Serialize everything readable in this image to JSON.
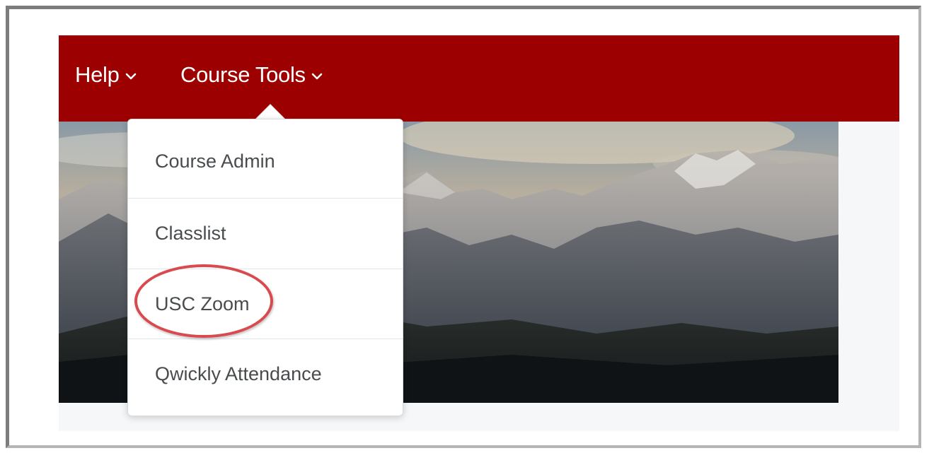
{
  "navbar": {
    "items": [
      {
        "label": "Help",
        "icon": "chevron-down-icon"
      },
      {
        "label": "Course Tools",
        "icon": "chevron-down-icon"
      }
    ],
    "background_color": "#9c0000"
  },
  "course_tools_menu": {
    "items": [
      {
        "label": "Course Admin"
      },
      {
        "label": "Classlist"
      },
      {
        "label": "USC Zoom",
        "highlighted": true
      },
      {
        "label": "Qwickly Attendance"
      }
    ]
  },
  "banner": {
    "image": "mountain-landscape"
  },
  "annotation": {
    "highlight_color": "#d94a4f",
    "target": "USC Zoom"
  }
}
